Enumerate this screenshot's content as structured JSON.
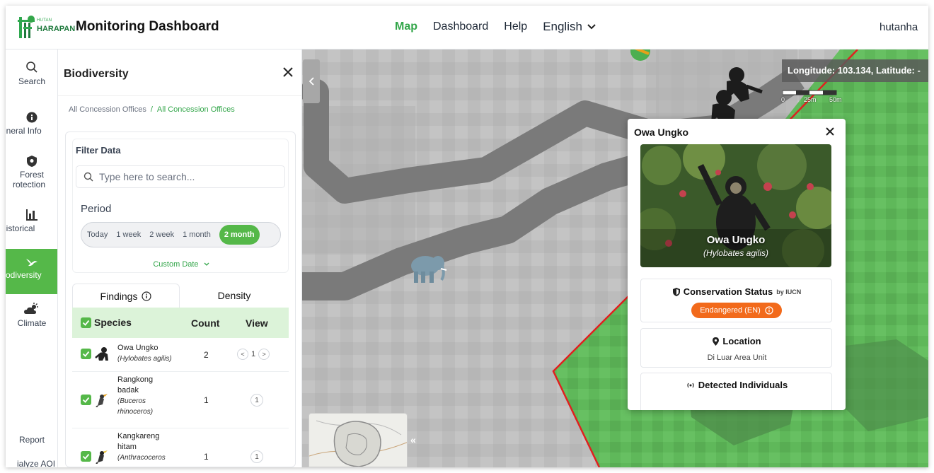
{
  "header": {
    "logo_small": "HUTAN",
    "logo_big": "HARAPAN",
    "title": "Monitoring Dashboard",
    "nav": [
      {
        "label": "Map",
        "active": true
      },
      {
        "label": "Dashboard",
        "active": false
      },
      {
        "label": "Help",
        "active": false
      }
    ],
    "language": "English",
    "user": "hutanha"
  },
  "rail": {
    "items": [
      {
        "label": "Search",
        "icon": "search-icon"
      },
      {
        "label": "eneral Info",
        "icon": "info-icon"
      },
      {
        "label_line1": "Forest",
        "label_line2": "rotection",
        "icon": "shield-icon"
      },
      {
        "label": "listorical",
        "icon": "bar-chart-icon"
      },
      {
        "label": "odiversity",
        "icon": "bird-icon",
        "active": true
      },
      {
        "label": "Climate",
        "icon": "cloud-sun-icon"
      }
    ],
    "bottom": [
      "Report",
      "ialyze AOI"
    ]
  },
  "panel": {
    "title": "Biodiversity",
    "breadcrumb": [
      "All Concession Offices",
      "All Concession Offices"
    ],
    "filter": {
      "title": "Filter Data",
      "search_placeholder": "Type here to search...",
      "period_label": "Period",
      "periods": [
        "Today",
        "1 week",
        "2 week",
        "1 month",
        "2 month"
      ],
      "active_period": "2 month",
      "custom_date": "Custom Date"
    },
    "tabs": [
      "Findings",
      "Density"
    ],
    "table": {
      "headers": {
        "species": "Species",
        "count": "Count",
        "view": "View"
      },
      "rows": [
        {
          "name": "Owa Ungko",
          "latin": "(Hylobates agilis)",
          "count": "2",
          "page": "1",
          "pager": true
        },
        {
          "name_lines": [
            "Rangkong",
            "badak"
          ],
          "latin_lines": [
            "(Buceros",
            "rhinoceros)"
          ],
          "count": "1",
          "page": "1",
          "pager": false
        },
        {
          "name_lines": [
            "Kangkareng",
            "hitam"
          ],
          "latin_lines": [
            "(Anthracoceros"
          ],
          "count": "1",
          "page": "1",
          "pager": false
        }
      ]
    }
  },
  "map": {
    "coordinates": "Longitude: 103.134, Latitude: -",
    "scale": [
      "0",
      "25m",
      "50m"
    ],
    "minimap_toggle": "«"
  },
  "popup": {
    "title": "Owa Ungko",
    "photo_name": "Owa Ungko",
    "photo_latin": "(Hylobates agilis)",
    "conservation": {
      "title": "Conservation Status",
      "by": "by IUCN",
      "status": "Endangered (EN)",
      "status_color": "#f26a1b"
    },
    "location": {
      "title": "Location",
      "value": "Di Luar Area Unit"
    },
    "detected": {
      "title": "Detected Individuals"
    }
  },
  "colors": {
    "accent": "#55b849",
    "accent_text": "#33a64a",
    "boundary": "#e02020",
    "forest": "#5fb85a"
  }
}
